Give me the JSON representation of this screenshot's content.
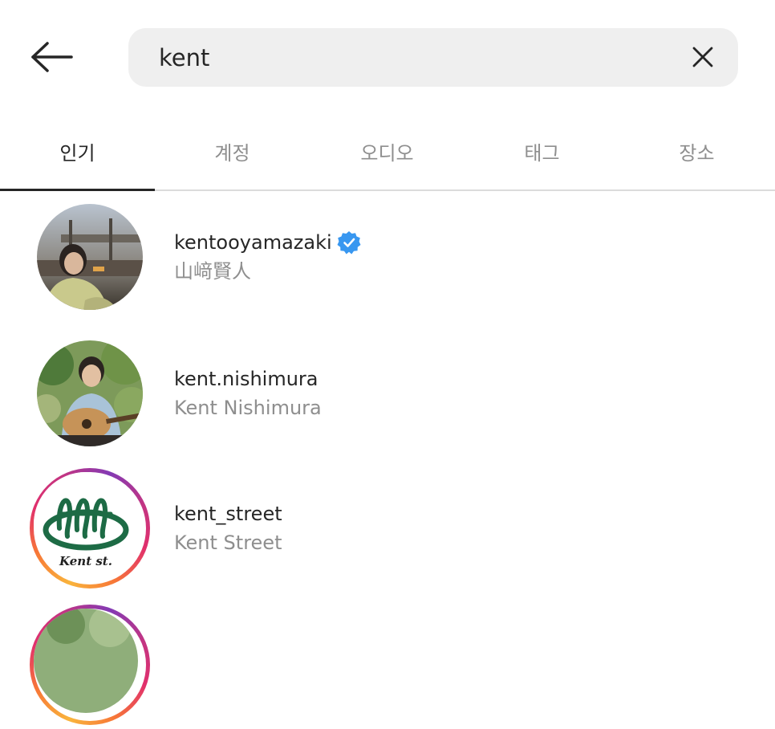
{
  "search": {
    "query": "kent"
  },
  "tabs": [
    {
      "label": "인기",
      "active": true
    },
    {
      "label": "계정",
      "active": false
    },
    {
      "label": "오디오",
      "active": false
    },
    {
      "label": "태그",
      "active": false
    },
    {
      "label": "장소",
      "active": false
    }
  ],
  "results": [
    {
      "username": "kentooyamazaki",
      "fullname": "山﨑賢人",
      "verified": true
    },
    {
      "username": "kent.nishimura",
      "fullname": "Kent Nishimura",
      "verified": false
    },
    {
      "username": "kent_street",
      "fullname": "Kent Street",
      "verified": false
    }
  ],
  "colors": {
    "verified_badge": "#3897f0",
    "muted_text": "#8e8e8e",
    "search_bg": "#efefef"
  }
}
